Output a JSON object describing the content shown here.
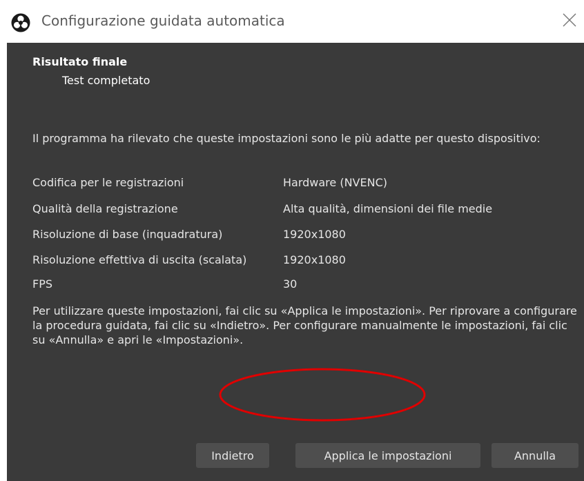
{
  "window": {
    "title": "Configurazione guidata automatica"
  },
  "section": {
    "title": "Risultato finale",
    "subtitle": "Test completato"
  },
  "intro_text": "Il programma ha rilevato che queste impostazioni sono le più adatte per questo dispositivo:",
  "settings": [
    {
      "label": "Codifica per le registrazioni",
      "value": "Hardware (NVENC)"
    },
    {
      "label": "Qualità della registrazione",
      "value": "Alta qualità, dimensioni dei file medie"
    },
    {
      "label": "Risoluzione di base (inquadratura)",
      "value": "1920x1080"
    },
    {
      "label": "Risoluzione effettiva di uscita (scalata)",
      "value": "1920x1080"
    },
    {
      "label": "FPS",
      "value": "30"
    }
  ],
  "outro_text": "Per utilizzare queste impostazioni, fai clic su «Applica le impostazioni». Per riprovare a configurare la procedura guidata, fai clic su «Indietro». Per configurare manualmente le impostazioni, fai clic su «Annulla» e apri le «Impostazioni».",
  "buttons": {
    "back": "Indietro",
    "apply": "Applica le impostazioni",
    "cancel": "Annulla"
  },
  "icons": {
    "app": "obs-logo-icon",
    "close": "close-icon"
  },
  "colors": {
    "panel_background": "#3a3a3a",
    "button_background": "#4e4e4e",
    "text": "#e6e6e6",
    "annotation": "#e00000"
  }
}
